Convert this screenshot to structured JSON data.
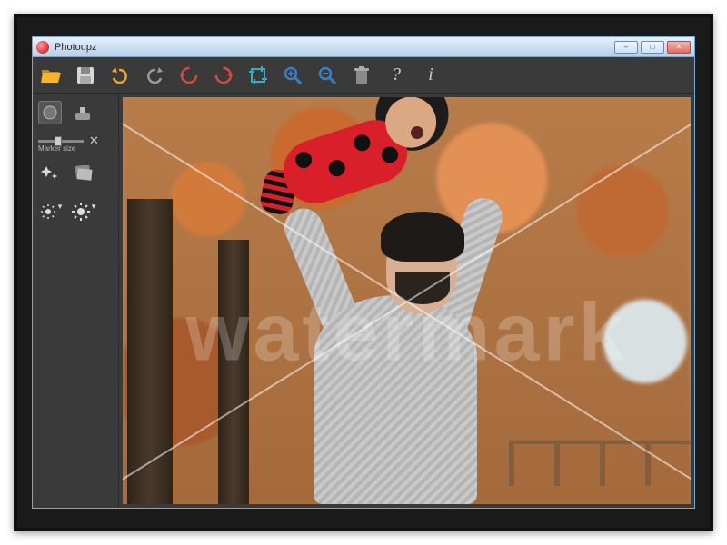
{
  "window": {
    "title": "Photoupz",
    "controls": {
      "min": "–",
      "max": "□",
      "close": "✕"
    }
  },
  "toolbar": {
    "open": {
      "name": "open-folder-icon"
    },
    "save": {
      "name": "save-icon"
    },
    "undo": {
      "name": "undo-icon"
    },
    "redo": {
      "name": "redo-icon"
    },
    "rotate_ccw": {
      "name": "rotate-ccw-icon"
    },
    "rotate_cw": {
      "name": "rotate-cw-icon"
    },
    "crop": {
      "name": "crop-icon"
    },
    "zoom_in": {
      "name": "zoom-in-icon"
    },
    "zoom_out": {
      "name": "zoom-out-icon"
    },
    "trash": {
      "name": "trash-icon"
    },
    "help": {
      "name": "help-icon",
      "glyph": "?"
    },
    "info": {
      "name": "info-icon",
      "glyph": "i"
    }
  },
  "sidebar": {
    "marker_brush": {
      "name": "circle-marker-icon"
    },
    "clone_tool": {
      "name": "clone-stamp-icon"
    },
    "marker_size_label": "Marker size",
    "clear_marker": {
      "name": "clear-x-icon"
    },
    "sparkle": {
      "name": "sparkle-icon"
    },
    "photos": {
      "name": "photos-stack-icon"
    },
    "brightness_down": {
      "name": "brightness-down-icon"
    },
    "brightness_up": {
      "name": "brightness-up-icon"
    }
  },
  "canvas": {
    "watermark_text": "watermark",
    "image_alt": "Father in grey sweater lifting baby in red ladybug costume among autumn trees"
  },
  "colors": {
    "accent_orange": "#f5a623",
    "accent_red": "#d91f2a",
    "accent_cyan": "#2fb0c4",
    "accent_blue": "#3a7fc4"
  }
}
